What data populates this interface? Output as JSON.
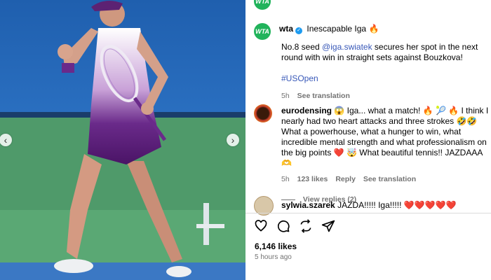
{
  "photo": {
    "alt_nav": {
      "prev": "‹",
      "next": "›"
    }
  },
  "post": {
    "avatar_text": "WTA",
    "username": "wta",
    "verified_mark": "✓",
    "dot": "·",
    "title": "Inescapable Iga",
    "title_emoji": "🔥",
    "caption_prefix": "No.8 seed ",
    "caption_mention": "@iga.swiatek",
    "caption_rest": " secures her spot in the next round with win in straight sets against Bouzkova!",
    "hashtag": "#USOpen",
    "age": "5h",
    "see_translation": "See translation"
  },
  "comments": [
    {
      "username": "eurodensing",
      "text": "😱 Iga... what a match! 🔥 🎾 🔥 I think I nearly had two heart attacks and three strokes 🤣🤣 What a powerhouse, what a hunger to win, what incredible mental strength and what professionalism on the big points ❤️ 🤯 What beautiful tennis!! JAZDAAA 🫶",
      "age": "5h",
      "likes": "123 likes",
      "reply": "Reply",
      "see_translation": "See translation",
      "view_replies": "View replies (2)"
    },
    {
      "username": "sylwia.szarek",
      "text": "JAZDA!!!!! Iga!!!!! ❤️❤️❤️❤️❤️"
    }
  ],
  "footer": {
    "likes": "6,146 likes",
    "time": "5 hours ago"
  },
  "colors": {
    "brand_green": "#21b35b",
    "link": "#3858b8"
  },
  "icons": [
    "heart-icon",
    "comment-icon",
    "share-icon",
    "send-icon"
  ]
}
